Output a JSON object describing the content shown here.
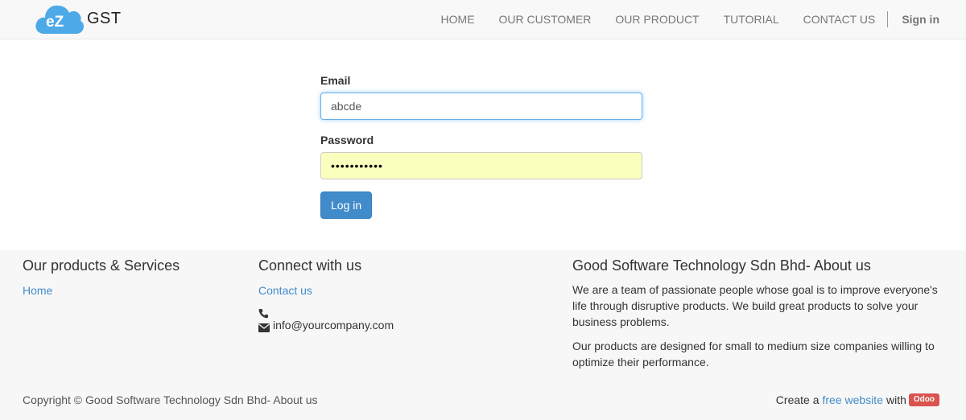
{
  "brand": {
    "logo_text": "GST",
    "logo_mark": "eZ"
  },
  "nav": {
    "items": [
      {
        "label": "HOME"
      },
      {
        "label": "OUR CUSTOMER"
      },
      {
        "label": "OUR PRODUCT"
      },
      {
        "label": "TUTORIAL"
      },
      {
        "label": "CONTACT US"
      }
    ],
    "signin_label": "Sign in"
  },
  "login": {
    "email_label": "Email",
    "email_value": "abcde",
    "password_label": "Password",
    "password_value": "•••••••••••",
    "submit_label": "Log in"
  },
  "footer": {
    "products": {
      "title": "Our products & Services",
      "links": [
        {
          "label": "Home"
        }
      ]
    },
    "connect": {
      "title": "Connect with us",
      "contact_link": "Contact us",
      "phone": "",
      "email": "info@yourcompany.com"
    },
    "about": {
      "title": "Good Software Technology Sdn Bhd- About us",
      "paragraph1": "We are a team of passionate people whose goal is to improve everyone's life through disruptive products. We build great products to solve your business problems.",
      "paragraph2": "Our products are designed for small to medium size companies willing to optimize their performance."
    },
    "copyright": "Copyright © Good Software Technology Sdn Bhd- About us",
    "created_prefix": "Create a",
    "created_link": "free website",
    "created_suffix": "with",
    "badge": "Odoo"
  },
  "colors": {
    "accent": "#428bca",
    "badge": "#d9534f",
    "autofill": "#faffbd",
    "logo": "#4da9e8"
  }
}
